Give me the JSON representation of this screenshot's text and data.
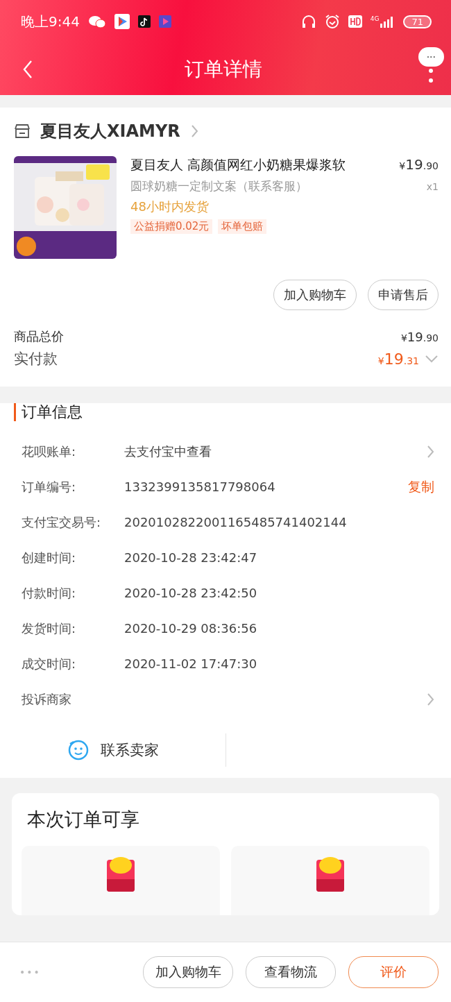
{
  "status_bar": {
    "time": "晚上9:44",
    "network": "4G",
    "battery": "71"
  },
  "header": {
    "title": "订单详情",
    "more": "···"
  },
  "shop": {
    "name": "夏目友人XIAMYR"
  },
  "item": {
    "kind": "picture",
    "title": "夏目友人 高颜值网红小奶糖果爆浆软",
    "sku": "圆球奶糖一定制文案（联系客服）",
    "delivery": "48小时内发货",
    "tags": [
      "公益捐赠0.02元",
      "坏单包赔"
    ],
    "price_main": "19",
    "price_decimal": ".90",
    "currency": "¥",
    "quantity": "x1"
  },
  "item_actions": [
    "加入购物车",
    "申请售后"
  ],
  "totals": [
    {
      "label": "商品总价",
      "currency": "¥",
      "amount": "19",
      "decimal": ".90",
      "emphasis": false
    },
    {
      "label": "实付款",
      "currency": "¥",
      "amount": "19",
      "decimal": ".31",
      "emphasis": true
    }
  ],
  "order_info": {
    "title": "订单信息",
    "rows": [
      {
        "label": "花呗账单:",
        "value": "去支付宝中查看",
        "chevron": true
      },
      {
        "label": "订单编号:",
        "value": "1332399135817798064",
        "action": "复制",
        "chevron": false
      },
      {
        "label": "支付宝交易号:",
        "value": "2020102822001165485741402144",
        "chevron": false
      },
      {
        "label": "创建时间:",
        "value": "2020-10-28 23:42:47",
        "chevron": false
      },
      {
        "label": "付款时间:",
        "value": "2020-10-28 23:42:50",
        "chevron": false
      },
      {
        "label": "发货时间:",
        "value": "2020-10-29 08:36:56",
        "chevron": false
      },
      {
        "label": "成交时间:",
        "value": "2020-11-02 17:47:30",
        "chevron": false
      },
      {
        "label": "投诉商家",
        "chevron": true
      }
    ],
    "contact": "联系卖家"
  },
  "benefits": {
    "title": "本次订单可享",
    "tiles": [
      {
        "kind": "envelope"
      },
      {
        "kind": "envelope"
      }
    ]
  },
  "bottom_bar": {
    "more": "•••",
    "buttons": [
      {
        "label": "加入购物车",
        "primary": false
      },
      {
        "label": "查看物流",
        "primary": false
      },
      {
        "label": "评价",
        "primary": true
      }
    ]
  }
}
